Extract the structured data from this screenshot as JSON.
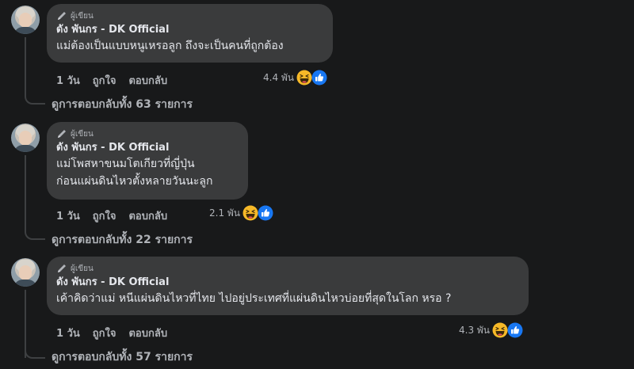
{
  "comments": [
    {
      "badge": "ผู้เขียน",
      "author": "ดัง พันกร - DK Official",
      "text": "แม่ต้องเป็นแบบหนูเหรอลูก ถึงจะเป็นคนที่ถูกต้อง",
      "time": "1 วัน",
      "like": "ถูกใจ",
      "reply": "ตอบกลับ",
      "reaction_count": "4.4 พัน",
      "view_replies": "ดูการตอบกลับทั้ง 63 รายการ"
    },
    {
      "badge": "ผู้เขียน",
      "author": "ดัง พันกร - DK Official",
      "text": "แม่โพสหาขนมโตเกียวที่ญี่ปุ่น\nก่อนแผ่นดินไหวตั้งหลายวันนะลูก",
      "time": "1 วัน",
      "like": "ถูกใจ",
      "reply": "ตอบกลับ",
      "reaction_count": "2.1 พัน",
      "view_replies": "ดูการตอบกลับทั้ง 22 รายการ"
    },
    {
      "badge": "ผู้เขียน",
      "author": "ดัง พันกร - DK Official",
      "text": "เค้าคิดว่าแม่ หนีแผ่นดินไหวที่ไทย ไปอยู่ประเทศที่แผ่นดินไหวบ่อยที่สุดในโลก หรอ ?",
      "time": "1 วัน",
      "like": "ถูกใจ",
      "reply": "ตอบกลับ",
      "reaction_count": "4.3 พัน",
      "view_replies": "ดูการตอบกลับทั้ง 57 รายการ"
    }
  ],
  "colors": {
    "background": "#18191a",
    "bubble": "#3a3b3c",
    "primary_text": "#e4e6eb",
    "secondary_text": "#b0b3b8",
    "like_blue": "#1877f2",
    "haha_yellow": "#f7b928"
  },
  "icons": [
    "author-pen-icon",
    "haha-reaction-icon",
    "like-reaction-icon"
  ]
}
